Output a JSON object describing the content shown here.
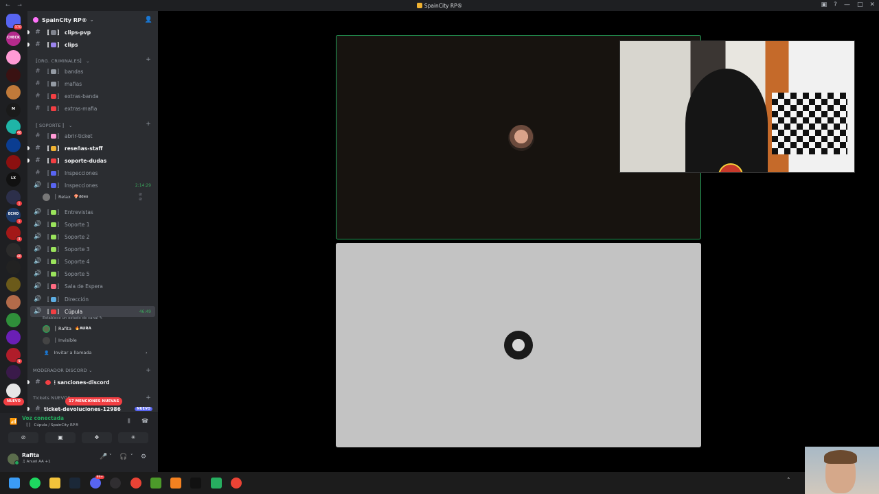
{
  "window": {
    "title": "SpainCity RP®",
    "nav_arrows": "← →",
    "controls": [
      "▣",
      "?",
      "—",
      "□",
      "✕"
    ]
  },
  "server_rail": {
    "items": [
      {
        "name": "direct-messages",
        "badge": "370",
        "color": "#5865f2"
      },
      {
        "name": "server-checkpoint",
        "badge": "",
        "label": "CHECK",
        "color": "#b42a8c"
      },
      {
        "name": "server-pink",
        "badge": "",
        "color": "#ff9ad5"
      },
      {
        "name": "server-red-dark",
        "badge": "",
        "color": "#3a1212"
      },
      {
        "name": "server-burger",
        "badge": "",
        "color": "#c07a3a"
      },
      {
        "name": "server-m",
        "badge": "",
        "label": "M",
        "color": "#1a1a1a"
      },
      {
        "name": "server-teal",
        "badge": "46",
        "color": "#1fb5a7"
      },
      {
        "name": "server-blue-x",
        "badge": "",
        "color": "#0b3d91"
      },
      {
        "name": "server-red-emblem",
        "badge": "",
        "color": "#8c1010"
      },
      {
        "name": "server-lx",
        "badge": "",
        "label": "LX",
        "color": "#111111"
      },
      {
        "name": "server-mountain",
        "badge": "1",
        "color": "#2c2f4a"
      },
      {
        "name": "server-echo",
        "badge": "1",
        "label": "ECHO",
        "color": "#1d3a6b"
      },
      {
        "name": "server-red-car",
        "badge": "3",
        "color": "#a31818"
      },
      {
        "name": "server-46",
        "badge": "46",
        "color": "#2b2b2b"
      },
      {
        "name": "server-race",
        "badge": "",
        "color": "#222222"
      },
      {
        "name": "server-gold",
        "badge": "",
        "color": "#6b5a1a"
      },
      {
        "name": "server-photo",
        "badge": "",
        "color": "#b36b4a"
      },
      {
        "name": "server-green",
        "badge": "",
        "color": "#2f8f3a"
      },
      {
        "name": "server-purple",
        "badge": "",
        "color": "#6a1fb5"
      },
      {
        "name": "server-red-9",
        "badge": "9",
        "color": "#b01d2a"
      },
      {
        "name": "server-dark-purple",
        "badge": "",
        "color": "#3a1a4a"
      },
      {
        "name": "server-shield",
        "badge": "",
        "color": "#e6e6e6"
      }
    ],
    "new_pill": "NUEVO"
  },
  "sidebar": {
    "server_name": "SpainCity RP®",
    "top_channels": [
      {
        "name": "clips-pvp",
        "prefix": "〚",
        "suffix": "〛",
        "emoji_color": "#80848e",
        "unread": true
      },
      {
        "name": "clips",
        "prefix": "〚",
        "suffix": "〛",
        "emoji_color": "#9b84ee",
        "unread": true
      }
    ],
    "cat_criminales": "〚ORG. CRIMINALES〛",
    "criminal_channels": [
      {
        "name": "bandas",
        "emoji_color": "#949ba4"
      },
      {
        "name": "mafias",
        "emoji_color": "#949ba4"
      },
      {
        "name": "extras-banda",
        "emoji_color": "#f23f43"
      },
      {
        "name": "extras-mafia",
        "emoji_color": "#f23f43"
      }
    ],
    "cat_soporte": "〚 SOPORTE 〛",
    "support_text_channels": [
      {
        "name": "abrir-ticket",
        "emoji_color": "#ff9ad5",
        "unread": false
      },
      {
        "name": "reseñas-staff",
        "emoji_color": "#f0b232",
        "unread": true
      },
      {
        "name": "soporte-dudas",
        "emoji_color": "#f23f43",
        "unread": true
      },
      {
        "name": "Inspecciones",
        "emoji_color": "#5865f2",
        "unread": false
      }
    ],
    "inspecciones_voice": {
      "name": "Inspecciones",
      "time": "2:14:29",
      "emoji_color": "#5865f2"
    },
    "inspecciones_user": {
      "name": "│ Relax",
      "tag": "🍄ddeo"
    },
    "voice_channels": [
      {
        "name": "Entrevistas",
        "emoji_color": "#9ae35c"
      },
      {
        "name": "Soporte 1",
        "emoji_color": "#9ae35c"
      },
      {
        "name": "Soporte 2",
        "emoji_color": "#9ae35c"
      },
      {
        "name": "Soporte 3",
        "emoji_color": "#9ae35c"
      },
      {
        "name": "Soporte 4",
        "emoji_color": "#9ae35c"
      },
      {
        "name": "Soporte 5",
        "emoji_color": "#9ae35c"
      },
      {
        "name": "Sala de Espera",
        "emoji_color": "#ff6b81"
      },
      {
        "name": "Dirección",
        "emoji_color": "#5dade2"
      }
    ],
    "cupula": {
      "name": "Cúpula",
      "time": "46:49",
      "status": "Establece un estado de canal ✎",
      "emoji_color": "#f23f43"
    },
    "cupula_users": [
      {
        "name": "│ Rafita",
        "tag": "🔥AURA",
        "color": "#5b6d4c"
      },
      {
        "name": "│ Invisible",
        "tag": "",
        "color": "#444444"
      }
    ],
    "invite_call": "Invitar a llamada",
    "cat_moderador": "MODERADOR DISCORD",
    "sanciones": "sanciones-discord",
    "cat_tickets": "Tickets NUEVOS",
    "tickets_channel": "ticket-devoluciones-12986",
    "tickets_badge": "NUEVO",
    "mentions_pill": "17 MENCIONES NUEVAS"
  },
  "voice_panel": {
    "status": "Voz conectada",
    "channel": "〚 〛 Cúpula / SpainCity RP®",
    "buttons": [
      "⊘",
      "▣",
      "❖",
      "✳"
    ]
  },
  "user_panel": {
    "name": "Rafita",
    "status": "♫ Anuel AA +1",
    "controls": [
      "🎤",
      "˅",
      "🎧",
      "˅",
      "⚙"
    ]
  },
  "taskbar": {
    "apps": [
      {
        "name": "windows-start",
        "color": "#3b9cf5"
      },
      {
        "name": "spotify",
        "color": "#1ed760"
      },
      {
        "name": "file-explorer",
        "color": "#f3c33b"
      },
      {
        "name": "steam",
        "color": "#1b2838"
      },
      {
        "name": "discord",
        "color": "#5865f2",
        "badge": "99+"
      },
      {
        "name": "obs",
        "color": "#302e31"
      },
      {
        "name": "chrome",
        "color": "#ea4335"
      },
      {
        "name": "minecraft",
        "color": "#4c9a2a"
      },
      {
        "name": "cloud-app",
        "color": "#f48120"
      },
      {
        "name": "capcut",
        "color": "#111111"
      },
      {
        "name": "archive-app",
        "color": "#27ae60"
      },
      {
        "name": "chrome-2",
        "color": "#ea4335"
      }
    ],
    "tray_caret": "˄"
  }
}
